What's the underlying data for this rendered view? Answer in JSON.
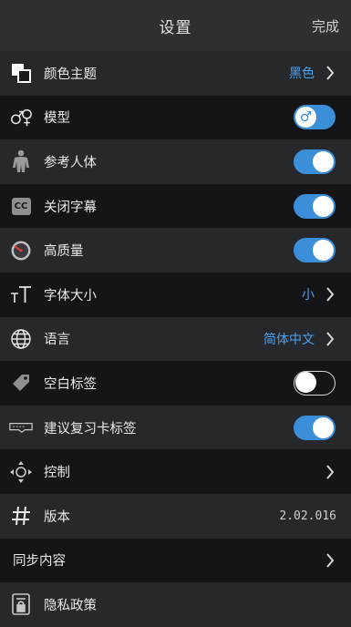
{
  "header": {
    "title": "设置",
    "done_label": "完成"
  },
  "rows": [
    {
      "label": "颜色主题",
      "value": "黑色"
    },
    {
      "label": "模型",
      "toggle_state": "off",
      "toggle_symbol": "♂"
    },
    {
      "label": "参考人体",
      "toggle_state": "on"
    },
    {
      "label": "关闭字幕",
      "icon_text": "CC",
      "toggle_state": "on"
    },
    {
      "label": "高质量",
      "toggle_state": "on"
    },
    {
      "label": "字体大小",
      "value": "小"
    },
    {
      "label": "语言",
      "value": "简体中文"
    },
    {
      "label": "空白标签",
      "toggle_state": "off"
    },
    {
      "label": "建议复习卡标签",
      "toggle_state": "on"
    },
    {
      "label": "控制"
    },
    {
      "label": "版本",
      "value": "2.02.016"
    },
    {
      "label": "同步内容"
    },
    {
      "label": "隐私政策"
    }
  ],
  "colors": {
    "accent": "#3b8fd9",
    "value_text": "#4aa3f0",
    "header_bg": "#2e2f33"
  }
}
